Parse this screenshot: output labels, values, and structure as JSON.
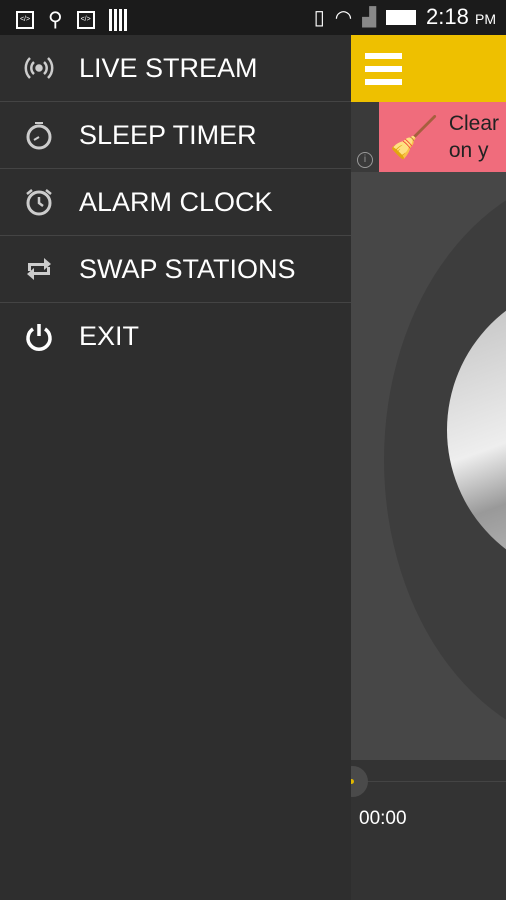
{
  "status_bar": {
    "time": "2:18",
    "ampm": "PM",
    "icons": [
      "code-icon",
      "usb-icon",
      "code-icon",
      "barcode-icon",
      "vibrate-icon",
      "wifi-icon",
      "signal-no-sim-icon",
      "battery-icon"
    ]
  },
  "drawer": {
    "items": [
      {
        "label": "LIVE STREAM",
        "icon": "radio-waves-icon"
      },
      {
        "label": "SLEEP TIMER",
        "icon": "stopwatch-icon"
      },
      {
        "label": "ALARM CLOCK",
        "icon": "alarm-clock-icon"
      },
      {
        "label": "SWAP STATIONS",
        "icon": "swap-icon"
      },
      {
        "label": "EXIT",
        "icon": "power-icon"
      }
    ]
  },
  "ad": {
    "line1": "Clear",
    "line2": "on y"
  },
  "player": {
    "elapsed": "00:00",
    "progress": 0
  },
  "colors": {
    "header": "#eec000",
    "ad": "#f06c7c",
    "drawer": "#2e2e2e"
  }
}
